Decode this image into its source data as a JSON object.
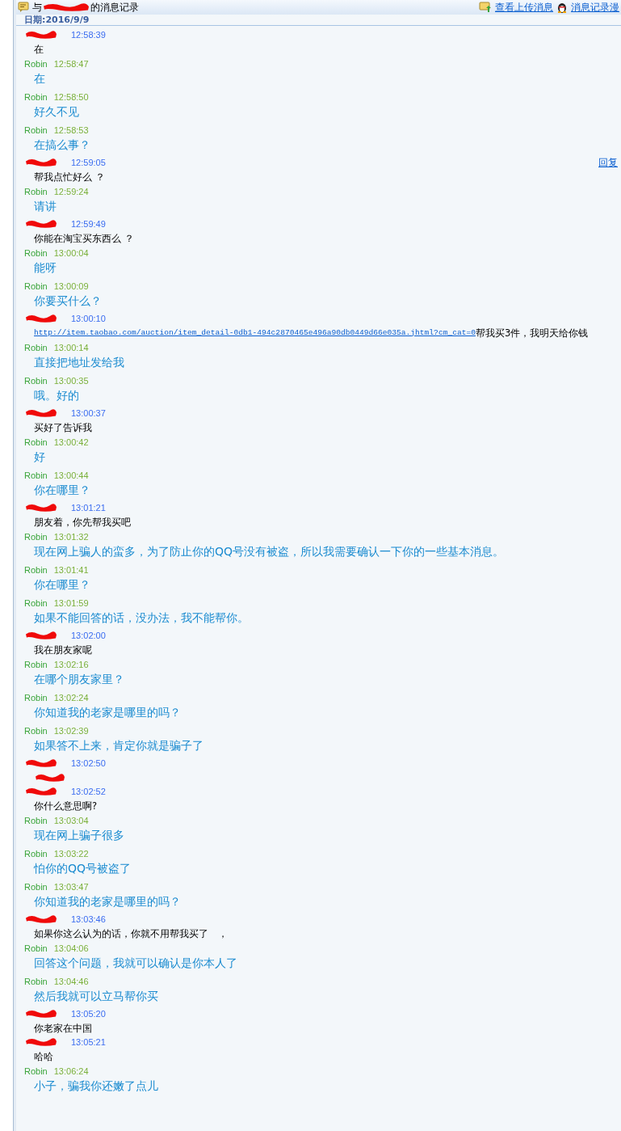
{
  "window": {
    "title_before": "与",
    "title_after": "的消息记录",
    "title_redacted": true
  },
  "toolbar": {
    "links": [
      {
        "label": "查看上传消息",
        "kind": "upload"
      },
      {
        "label": "消息记录漫",
        "kind": "penguin"
      }
    ]
  },
  "date_line": "日期:2016/9/9",
  "messages": [
    {
      "kind": "other",
      "name_redacted": true,
      "time": "12:58:39",
      "text": "在"
    },
    {
      "kind": "me",
      "name": "Robin",
      "time": "12:58:47",
      "text": "在"
    },
    {
      "kind": "me",
      "name": "Robin",
      "time": "12:58:50",
      "text": "好久不见"
    },
    {
      "kind": "me",
      "name": "Robin",
      "time": "12:58:53",
      "text": "在搞么事？"
    },
    {
      "kind": "other",
      "name_redacted": true,
      "time": "12:59:05",
      "text": "帮我点忙好么 ？",
      "reply": "回复"
    },
    {
      "kind": "me",
      "name": "Robin",
      "time": "12:59:24",
      "text": "请讲"
    },
    {
      "kind": "other",
      "name_redacted": true,
      "time": "12:59:49",
      "text": "你能在淘宝买东西么 ？"
    },
    {
      "kind": "me",
      "name": "Robin",
      "time": "13:00:04",
      "text": "能呀"
    },
    {
      "kind": "me",
      "name": "Robin",
      "time": "13:00:09",
      "text": "你要买什么？"
    },
    {
      "kind": "other",
      "name_redacted": true,
      "time": "13:00:10",
      "link": "http://item.taobao.com/auction/item_detail-0db1-494c2870465e496a90db0449d66e035a.jhtml?cm_cat=0",
      "text": "帮我买3件，我明天给你钱"
    },
    {
      "kind": "me",
      "name": "Robin",
      "time": "13:00:14",
      "text": "直接把地址发给我"
    },
    {
      "kind": "me",
      "name": "Robin",
      "time": "13:00:35",
      "text": "哦。好的"
    },
    {
      "kind": "other",
      "name_redacted": true,
      "time": "13:00:37",
      "text": "买好了告诉我"
    },
    {
      "kind": "me",
      "name": "Robin",
      "time": "13:00:42",
      "text": "好"
    },
    {
      "kind": "me",
      "name": "Robin",
      "time": "13:00:44",
      "text": "你在哪里？"
    },
    {
      "kind": "other",
      "name_redacted": true,
      "time": "13:01:21",
      "text": "朋友着，你先帮我买吧"
    },
    {
      "kind": "me",
      "name": "Robin",
      "time": "13:01:32",
      "text": "现在网上骗人的蛮多，为了防止你的QQ号没有被盗，所以我需要确认一下你的一些基本消息。"
    },
    {
      "kind": "me",
      "name": "Robin",
      "time": "13:01:41",
      "text": "你在哪里？"
    },
    {
      "kind": "me",
      "name": "Robin",
      "time": "13:01:59",
      "text": "如果不能回答的话，没办法，我不能帮你。"
    },
    {
      "kind": "other",
      "name_redacted": true,
      "time": "13:02:00",
      "text": "我在朋友家呢"
    },
    {
      "kind": "me",
      "name": "Robin",
      "time": "13:02:16",
      "text": "在哪个朋友家里？"
    },
    {
      "kind": "me",
      "name": "Robin",
      "time": "13:02:24",
      "text": "你知道我的老家是哪里的吗？"
    },
    {
      "kind": "me",
      "name": "Robin",
      "time": "13:02:39",
      "text": "如果答不上来，肯定你就是骗子了"
    },
    {
      "kind": "other",
      "name_redacted": true,
      "time": "13:02:50",
      "text_redacted": true
    },
    {
      "kind": "other",
      "name_redacted": true,
      "time": "13:02:52",
      "text": "你什么意思啊?"
    },
    {
      "kind": "me",
      "name": "Robin",
      "time": "13:03:04",
      "text": "现在网上骗子很多"
    },
    {
      "kind": "me",
      "name": "Robin",
      "time": "13:03:22",
      "text": "怕你的QQ号被盗了"
    },
    {
      "kind": "me",
      "name": "Robin",
      "time": "13:03:47",
      "text": "你知道我的老家是哪里的吗？"
    },
    {
      "kind": "other",
      "name_redacted": true,
      "time": "13:03:46",
      "text": "如果你这么认为的话，你就不用帮我买了　，"
    },
    {
      "kind": "me",
      "name": "Robin",
      "time": "13:04:06",
      "text": "回答这个问题，我就可以确认是你本人了"
    },
    {
      "kind": "me",
      "name": "Robin",
      "time": "13:04:46",
      "text": "然后我就可以立马帮你买"
    },
    {
      "kind": "other",
      "name_redacted": true,
      "time": "13:05:20",
      "text": "你老家在中国"
    },
    {
      "kind": "other",
      "name_redacted": true,
      "time": "13:05:21",
      "text": "哈哈"
    },
    {
      "kind": "me",
      "name": "Robin",
      "time": "13:06:24",
      "text": "小子，骗我你还嫩了点儿"
    }
  ]
}
